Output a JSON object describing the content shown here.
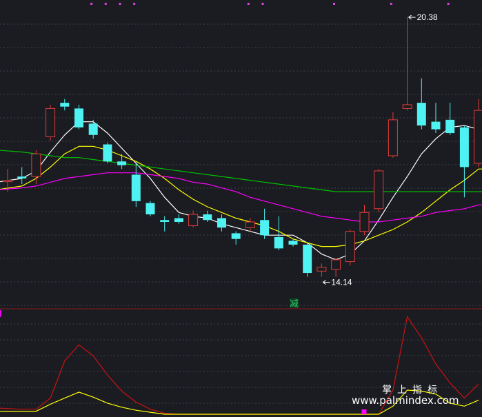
{
  "chart_data": [
    {
      "type": "candlestick",
      "title": "",
      "grid": true,
      "ylim": [
        13.2,
        20.6
      ],
      "candles": [
        {
          "o": 16.05,
          "c": 16.05,
          "h": 16.35,
          "l": 15.75,
          "color": "red"
        },
        {
          "o": 16.15,
          "c": 16.1,
          "h": 16.4,
          "l": 15.95,
          "color": "cyan"
        },
        {
          "o": 16.15,
          "c": 16.75,
          "h": 16.85,
          "l": 15.95,
          "color": "red"
        },
        {
          "o": 17.2,
          "c": 17.95,
          "h": 18.05,
          "l": 17.1,
          "color": "red"
        },
        {
          "o": 18.1,
          "c": 18.0,
          "h": 18.2,
          "l": 17.9,
          "color": "cyan"
        },
        {
          "o": 17.95,
          "c": 17.45,
          "h": 18.05,
          "l": 17.4,
          "color": "cyan"
        },
        {
          "o": 17.55,
          "c": 17.25,
          "h": 17.65,
          "l": 17.15,
          "color": "cyan"
        },
        {
          "o": 17.0,
          "c": 16.55,
          "h": 17.05,
          "l": 16.5,
          "color": "cyan"
        },
        {
          "o": 16.55,
          "c": 16.45,
          "h": 16.75,
          "l": 16.35,
          "color": "cyan"
        },
        {
          "o": 16.2,
          "c": 15.5,
          "h": 16.5,
          "l": 15.35,
          "color": "cyan"
        },
        {
          "o": 15.45,
          "c": 15.15,
          "h": 15.5,
          "l": 15.1,
          "color": "cyan"
        },
        {
          "o": 15.0,
          "c": 14.95,
          "h": 15.1,
          "l": 14.7,
          "color": "cyan"
        },
        {
          "o": 15.05,
          "c": 14.95,
          "h": 15.15,
          "l": 14.9,
          "color": "cyan"
        },
        {
          "o": 14.85,
          "c": 15.15,
          "h": 15.25,
          "l": 14.8,
          "color": "red"
        },
        {
          "o": 15.15,
          "c": 15.0,
          "h": 15.25,
          "l": 14.95,
          "color": "cyan"
        },
        {
          "o": 15.05,
          "c": 14.8,
          "h": 15.15,
          "l": 14.7,
          "color": "cyan"
        },
        {
          "o": 14.65,
          "c": 14.5,
          "h": 14.7,
          "l": 14.35,
          "color": "cyan"
        },
        {
          "o": 14.8,
          "c": 14.95,
          "h": 15.05,
          "l": 14.7,
          "color": "red"
        },
        {
          "o": 15.0,
          "c": 14.6,
          "h": 15.3,
          "l": 14.5,
          "color": "cyan"
        },
        {
          "o": 14.55,
          "c": 14.25,
          "h": 15.1,
          "l": 14.2,
          "color": "cyan"
        },
        {
          "o": 14.45,
          "c": 14.35,
          "h": 14.5,
          "l": 14.3,
          "color": "cyan"
        },
        {
          "o": 14.35,
          "c": 13.6,
          "h": 14.4,
          "l": 13.5,
          "color": "cyan"
        },
        {
          "o": 13.65,
          "c": 13.75,
          "h": 13.85,
          "l": 13.5,
          "color": "red"
        },
        {
          "o": 13.7,
          "c": 13.95,
          "h": 14.0,
          "l": 13.5,
          "color": "red"
        },
        {
          "o": 13.9,
          "c": 14.7,
          "h": 14.75,
          "l": 13.8,
          "color": "red"
        },
        {
          "o": 14.7,
          "c": 15.2,
          "h": 15.4,
          "l": 14.6,
          "color": "red"
        },
        {
          "o": 15.3,
          "c": 16.3,
          "h": 16.35,
          "l": 15.2,
          "color": "red"
        },
        {
          "o": 16.7,
          "c": 17.65,
          "h": 17.85,
          "l": 16.65,
          "color": "red"
        },
        {
          "o": 17.95,
          "c": 18.05,
          "h": 20.38,
          "l": 17.9,
          "color": "red"
        },
        {
          "o": 18.1,
          "c": 17.5,
          "h": 18.75,
          "l": 17.4,
          "color": "cyan"
        },
        {
          "o": 17.6,
          "c": 17.4,
          "h": 18.1,
          "l": 17.3,
          "color": "cyan"
        },
        {
          "o": 17.65,
          "c": 17.3,
          "h": 18.1,
          "l": 17.25,
          "color": "cyan"
        },
        {
          "o": 17.45,
          "c": 16.4,
          "h": 17.5,
          "l": 15.6,
          "color": "cyan"
        },
        {
          "o": 16.5,
          "c": 17.9,
          "h": 18.2,
          "l": 16.4,
          "color": "red"
        }
      ],
      "moving_averages": [
        {
          "color": "#ffffff",
          "values": [
            16.0,
            16.1,
            16.3,
            16.8,
            17.25,
            17.6,
            17.6,
            17.3,
            16.9,
            16.5,
            16.1,
            15.6,
            15.2,
            15.1,
            15.05,
            14.9,
            14.8,
            14.7,
            14.6,
            14.6,
            14.6,
            14.4,
            14.1,
            13.95,
            14.1,
            14.45,
            15.0,
            15.6,
            16.15,
            16.75,
            17.15,
            17.45,
            17.5,
            17.4
          ]
        },
        {
          "color": "#ffff00",
          "values": [
            15.8,
            15.9,
            16.1,
            16.4,
            16.75,
            16.95,
            16.95,
            16.85,
            16.7,
            16.55,
            16.35,
            16.1,
            15.8,
            15.55,
            15.35,
            15.2,
            15.05,
            14.95,
            14.85,
            14.7,
            14.5,
            14.4,
            14.3,
            14.3,
            14.35,
            14.45,
            14.6,
            14.75,
            14.95,
            15.2,
            15.5,
            15.8,
            16.05,
            16.35
          ]
        },
        {
          "color": "#ff00ff",
          "values": [
            15.8,
            15.85,
            15.9,
            16.0,
            16.1,
            16.15,
            16.2,
            16.25,
            16.25,
            16.25,
            16.2,
            16.15,
            16.1,
            16.0,
            15.95,
            15.85,
            15.75,
            15.6,
            15.5,
            15.4,
            15.3,
            15.2,
            15.1,
            15.05,
            15.0,
            14.95,
            14.95,
            15.0,
            15.05,
            15.1,
            15.2,
            15.25,
            15.3,
            15.4
          ]
        },
        {
          "color": "#00c000",
          "values": [
            16.85,
            16.8,
            16.75,
            16.7,
            16.65,
            16.65,
            16.6,
            16.55,
            16.5,
            16.45,
            16.4,
            16.35,
            16.3,
            16.25,
            16.2,
            16.15,
            16.1,
            16.05,
            16.0,
            15.95,
            15.9,
            15.85,
            15.8,
            15.75,
            15.75,
            15.75,
            15.75,
            15.75,
            15.75,
            15.75,
            15.75,
            15.75,
            15.75,
            15.75
          ]
        }
      ],
      "annotations": [
        {
          "text": "20.38",
          "index": 28,
          "price": 20.38
        },
        {
          "text": "14.14",
          "index": 22,
          "price": 13.5
        }
      ],
      "signal": {
        "text": "减",
        "index": 20
      },
      "top_markers": [
        3,
        4,
        5,
        6,
        14,
        15,
        20,
        24,
        28
      ]
    },
    {
      "type": "line",
      "title": "",
      "ylim": [
        0,
        10
      ],
      "series": [
        {
          "color": "#cc1111",
          "values": [
            0.6,
            0.5,
            0.5,
            1.6,
            5.3,
            6.9,
            5.8,
            3.9,
            2.3,
            1.2,
            0.5,
            0.1,
            0.0,
            0.0,
            0.0,
            0.0,
            0.0,
            0.0,
            0.0,
            0.0,
            0.0,
            0.0,
            0.0,
            0.0,
            0.0,
            0.0,
            0.0,
            2.4,
            9.7,
            7.6,
            5.0,
            3.1,
            1.6,
            3.0
          ]
        },
        {
          "color": "#ffff00",
          "values": [
            0.3,
            0.3,
            0.3,
            1.0,
            1.6,
            2.2,
            1.7,
            1.1,
            0.7,
            0.4,
            0.2,
            0.0,
            0.0,
            0.0,
            0.0,
            0.0,
            0.0,
            0.0,
            0.0,
            0.0,
            0.0,
            0.0,
            0.0,
            0.0,
            0.0,
            0.0,
            0.0,
            0.8,
            2.4,
            2.3,
            2.0,
            1.1,
            0.8,
            1.4
          ]
        }
      ],
      "marker_index": 25
    }
  ],
  "watermark": {
    "cn": "掌上指标",
    "url": "www.palmindex.com"
  }
}
